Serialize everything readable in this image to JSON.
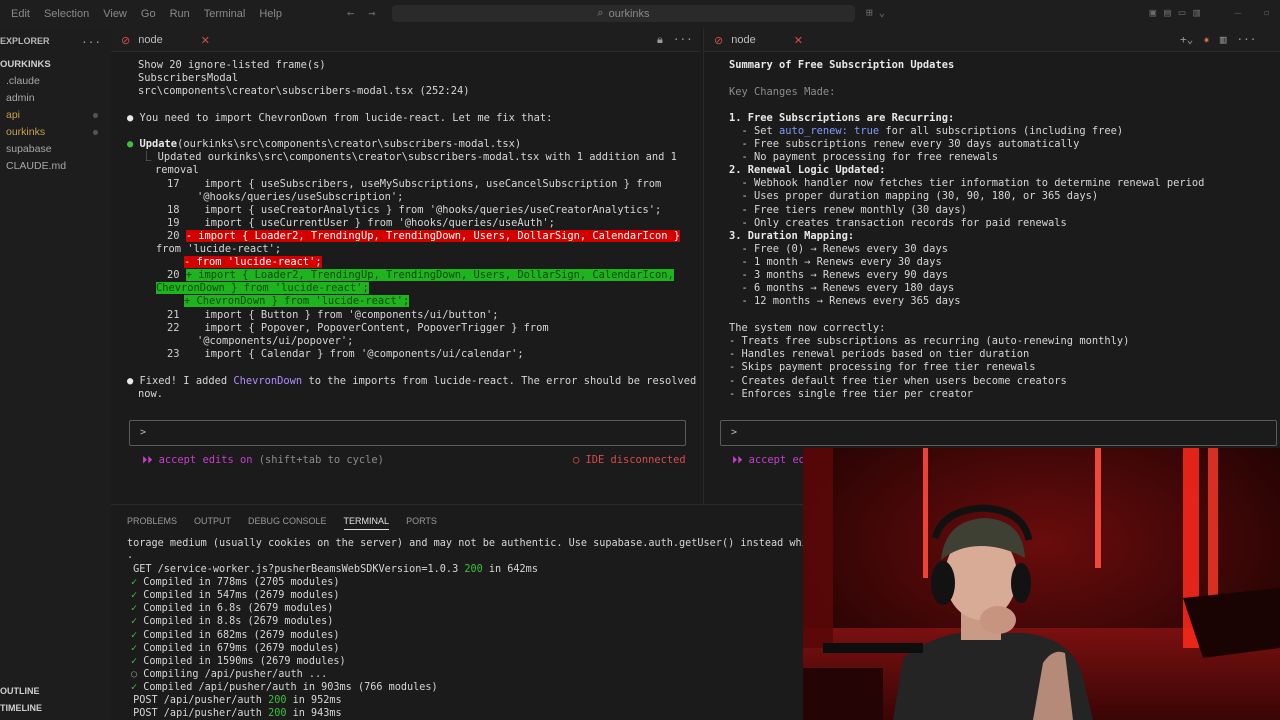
{
  "menu": [
    "Edit",
    "Selection",
    "View",
    "Go",
    "Run",
    "Terminal",
    "Help"
  ],
  "search": {
    "text": "ourkinks"
  },
  "explorer": {
    "title": "EXPLORER",
    "root": "OURKINKS",
    "items": [
      ".claude",
      "admin",
      "api",
      "ourkinks",
      "supabase",
      "CLAUDE.md"
    ],
    "outline": "OUTLINE",
    "timeline": "TIMELINE"
  },
  "left": {
    "tab": "node",
    "lines": {
      "l1": "Show 20 ignore-listed frame(s)",
      "l2": "SubscribersModal",
      "l3": "src\\components\\creator\\subscribers-modal.tsx (252:24)",
      "l4": "You need to import ChevronDown from lucide-react. Let me fix that:",
      "l5a": "Update",
      "l5b": "(ourkinks\\src\\components\\creator\\subscribers-modal.tsx)",
      "l6": "Updated ourkinks\\src\\components\\creator\\subscribers-modal.tsx with 1 addition and 1",
      "l7": "removal",
      "l8n": "17",
      "l8": "import { useSubscribers, useMySubscriptions, useCancelSubscription } from",
      "l9": "'@hooks/queries/useSubscription';",
      "l10n": "18",
      "l10": "import { useCreatorAnalytics } from '@hooks/queries/useCreatorAnalytics';",
      "l11n": "19",
      "l11": "import { useCurrentUser } from '@hooks/queries/useAuth';",
      "l12n": "20",
      "l12": "- import { Loader2, TrendingUp, TrendingDown, Users, DollarSign, CalendarIcon }",
      "l13": "from 'lucide-react';",
      "l14": "- from 'lucide-react';",
      "l15n": "20",
      "l15": "+ import { Loader2, TrendingUp, TrendingDown, Users, DollarSign, CalendarIcon,",
      "l16": "ChevronDown } from 'lucide-react';",
      "l17": "+ ChevronDown } from 'lucide-react';",
      "l18n": "21",
      "l18": "import { Button } from '@components/ui/button';",
      "l19n": "22",
      "l19": "import { Popover, PopoverContent, PopoverTrigger } from",
      "l20": "'@components/ui/popover';",
      "l21n": "23",
      "l21": "import { Calendar } from '@components/ui/calendar';",
      "l22a": "Fixed! I added ",
      "l22b": "ChevronDown",
      "l22c": " to the imports from lucide-react. The error should be resolved",
      "l23": "now."
    },
    "prompt": ">",
    "mode": "accept edits on",
    "mode_hint": "(shift+tab to cycle)",
    "ide_status": "IDE disconnected"
  },
  "right": {
    "tab": "node",
    "lines": {
      "title": "Summary of Free Subscription Updates",
      "key": "Key Changes Made:",
      "h1": "1. Free Subscriptions are Recurring:",
      "r1a": "  - Set ",
      "r1b": "auto_renew: true",
      "r1c": " for all subscriptions (including free)",
      "r2": "  - Free subscriptions renew every 30 days automatically",
      "r3": "  - No payment processing for free renewals",
      "h2": "2. Renewal Logic Updated:",
      "r4": "  - Webhook handler now fetches tier information to determine renewal period",
      "r5": "  - Uses proper duration mapping (30, 90, 180, or 365 days)",
      "r6": "  - Free tiers renew monthly (30 days)",
      "r7": "  - Only creates transaction records for paid renewals",
      "h3": "3. Duration Mapping:",
      "r8": "  - Free (0) → Renews every 30 days",
      "r9": "  - 1 month → Renews every 30 days",
      "r10": "  - 3 months → Renews every 90 days",
      "r11": "  - 6 months → Renews every 180 days",
      "r12": "  - 12 months → Renews every 365 days",
      "sys": "The system now correctly:",
      "s1": "- Treats free subscriptions as recurring (auto-renewing monthly)",
      "s2": "- Handles renewal periods based on tier duration",
      "s3": "- Skips payment processing for free tier renewals",
      "s4": "- Creates default free tier when users become creators",
      "s5": "- Enforces single free tier per creator"
    },
    "prompt": ">",
    "mode": "accept edi"
  },
  "panel": {
    "tabs": [
      "PROBLEMS",
      "OUTPUT",
      "DEBUG CONSOLE",
      "TERMINAL",
      "PORTS"
    ],
    "lines": {
      "t1": "torage medium (usually cookies on the server) and may not be authentic. Use supabase.auth.getUser() instead which aut",
      "t2": ".",
      "t3a": " GET /service-worker.js?pusherBeamsWebSDKVersion=1.0.3 ",
      "t3b": "200",
      "t3c": " in 642ms",
      "c1": " Compiled in 778ms (2705 modules)",
      "c2": " Compiled in 547ms (2679 modules)",
      "c3": " Compiled in 6.8s (2679 modules)",
      "c4": " Compiled in 8.8s (2679 modules)",
      "c5": " Compiled in 682ms (2679 modules)",
      "c6": " Compiled in 679ms (2679 modules)",
      "c7": " Compiled in 1590ms (2679 modules)",
      "c8": " Compiling /api/pusher/auth ...",
      "c9": " Compiled /api/pusher/auth in 903ms (766 modules)",
      "p1a": " POST /api/pusher/auth ",
      "p1b": "200",
      "p1c": " in 952ms",
      "p2a": " POST /api/pusher/auth ",
      "p2b": "200",
      "p2c": " in 943ms"
    }
  },
  "colors": {
    "removed_bg": "#d40000",
    "added_bg": "#1fb31f",
    "accent_pink": "#c93ccf",
    "success": "#3bc23b"
  }
}
